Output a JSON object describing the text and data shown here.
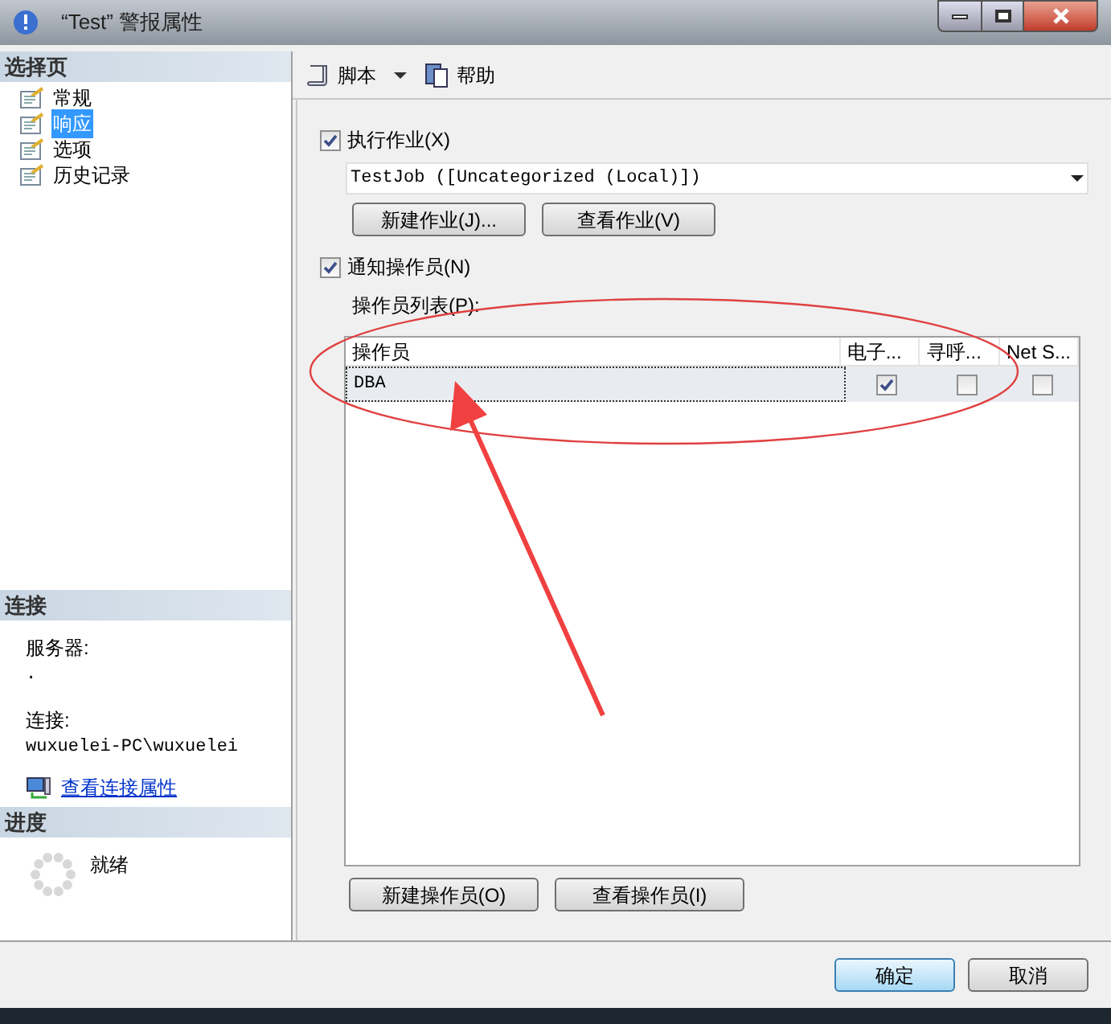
{
  "window": {
    "title": "“Test” 警报属性"
  },
  "sidebar": {
    "header": "选择页",
    "items": [
      {
        "label": "常规",
        "selected": false
      },
      {
        "label": "响应",
        "selected": true
      },
      {
        "label": "选项",
        "selected": false
      },
      {
        "label": "历史记录",
        "selected": false
      }
    ]
  },
  "connection": {
    "header": "连接",
    "server_label": "服务器:",
    "server_value": ".",
    "connection_label": "连接:",
    "connection_value": "wuxuelei-PC\\wuxuelei",
    "link": "查看连接属性"
  },
  "progress": {
    "header": "进度",
    "status": "就绪"
  },
  "toolbar": {
    "script": "脚本",
    "help": "帮助"
  },
  "execute_job": {
    "label": "执行作业(X)",
    "checked": true
  },
  "job_select": {
    "value": "TestJob ([Uncategorized (Local)])"
  },
  "job_buttons": [
    "新建作业(J)...",
    "查看作业(V)"
  ],
  "notify_operators": {
    "label": "通知操作员(N)",
    "checked": true
  },
  "operator_list": {
    "label": "操作员列表(P):",
    "columns": [
      "操作员",
      "电子...",
      "寻呼...",
      "Net S..."
    ],
    "rows": [
      {
        "name": "DBA",
        "selected": true,
        "email": true,
        "pager": false,
        "net_send": false
      }
    ]
  },
  "operator_buttons": [
    "新建操作员(O)",
    "查看操作员(I)"
  ],
  "dialog_buttons": [
    {
      "label": "确定",
      "default": true
    },
    {
      "label": "取消",
      "default": false
    }
  ]
}
